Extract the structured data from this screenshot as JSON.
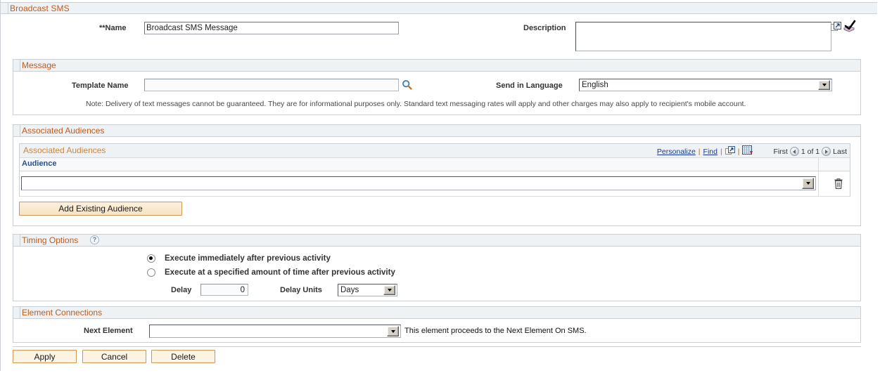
{
  "page": {
    "title": "Broadcast SMS"
  },
  "header": {
    "name_label": "**Name",
    "name_value": "Broadcast SMS Message",
    "description_label": "Description",
    "description_value": "",
    "expand_icon": "expand-window-icon",
    "spellcheck_icon": "spellcheck-icon"
  },
  "message": {
    "section_title": "Message",
    "template_label": "Template Name",
    "template_value": "",
    "lookup_icon": "magnifier-lookup-icon",
    "language_label": "Send in Language",
    "language_value": "English",
    "language_options": [
      "English"
    ],
    "note": "Note: Delivery of text messages cannot be guaranteed. They are for informational purposes only. Standard text messaging rates will apply and other charges may also apply to recipient's mobile account."
  },
  "audiences": {
    "section_title": "Associated Audiences",
    "grid_title": "Associated Audiences",
    "toolbar": {
      "personalize": "Personalize",
      "find": "Find",
      "sep": "|",
      "view_all_icon": "view-all-expand-icon",
      "download_icon": "download-to-excel-icon",
      "first": "First",
      "count": "1 of 1",
      "last": "Last",
      "prev_icon": "prev-page-icon",
      "next_icon": "next-page-icon"
    },
    "column_header": "Audience",
    "rows": [
      {
        "value": "",
        "delete_icon": "trash-delete-icon"
      }
    ],
    "add_button": "Add Existing Audience"
  },
  "timing": {
    "section_title": "Timing Options",
    "help_icon": "help-question-icon",
    "help_label": "?",
    "option_immediate": "Execute immediately after previous activity",
    "option_delayed": "Execute at a specified amount of time after previous activity",
    "selected": "immediate",
    "delay_label": "Delay",
    "delay_value": "0",
    "delay_units_label": "Delay Units",
    "delay_units_value": "Days",
    "delay_units_options": [
      "Days"
    ]
  },
  "connections": {
    "section_title": "Element Connections",
    "next_element_label": "Next Element",
    "next_element_value": "",
    "hint": "This element proceeds to the Next Element On SMS."
  },
  "footer": {
    "apply": "Apply",
    "cancel": "Cancel",
    "delete": "Delete"
  },
  "colors": {
    "section_title_text": "#c05b1a",
    "link": "#19398a",
    "grid_col_header": "#28508f",
    "button_border": "#c99a58",
    "panel_bg": "#eef2f5"
  }
}
